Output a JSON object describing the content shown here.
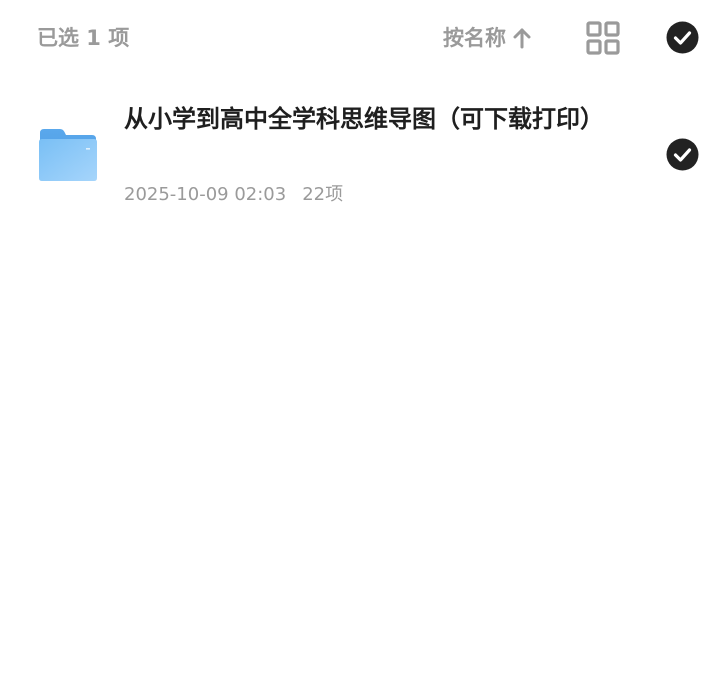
{
  "header": {
    "selected_count": "已选 1 项",
    "sort_label": "按名称",
    "sort_direction_icon": "arrow-up-icon",
    "view_toggle_icon": "grid-view-icon",
    "select_all_icon": "check-circle-icon"
  },
  "files": [
    {
      "name": "从小学到高中全学科思维导图（可下载打印）",
      "modified": "2025-10-09 02:03",
      "item_count": "22项",
      "icon": "folder-icon",
      "selected": true
    }
  ],
  "colors": {
    "muted_text": "#9a9a9a",
    "primary_text": "#1f1f1f",
    "check_fill": "#222222",
    "folder_blue": "#6bb5f0"
  }
}
